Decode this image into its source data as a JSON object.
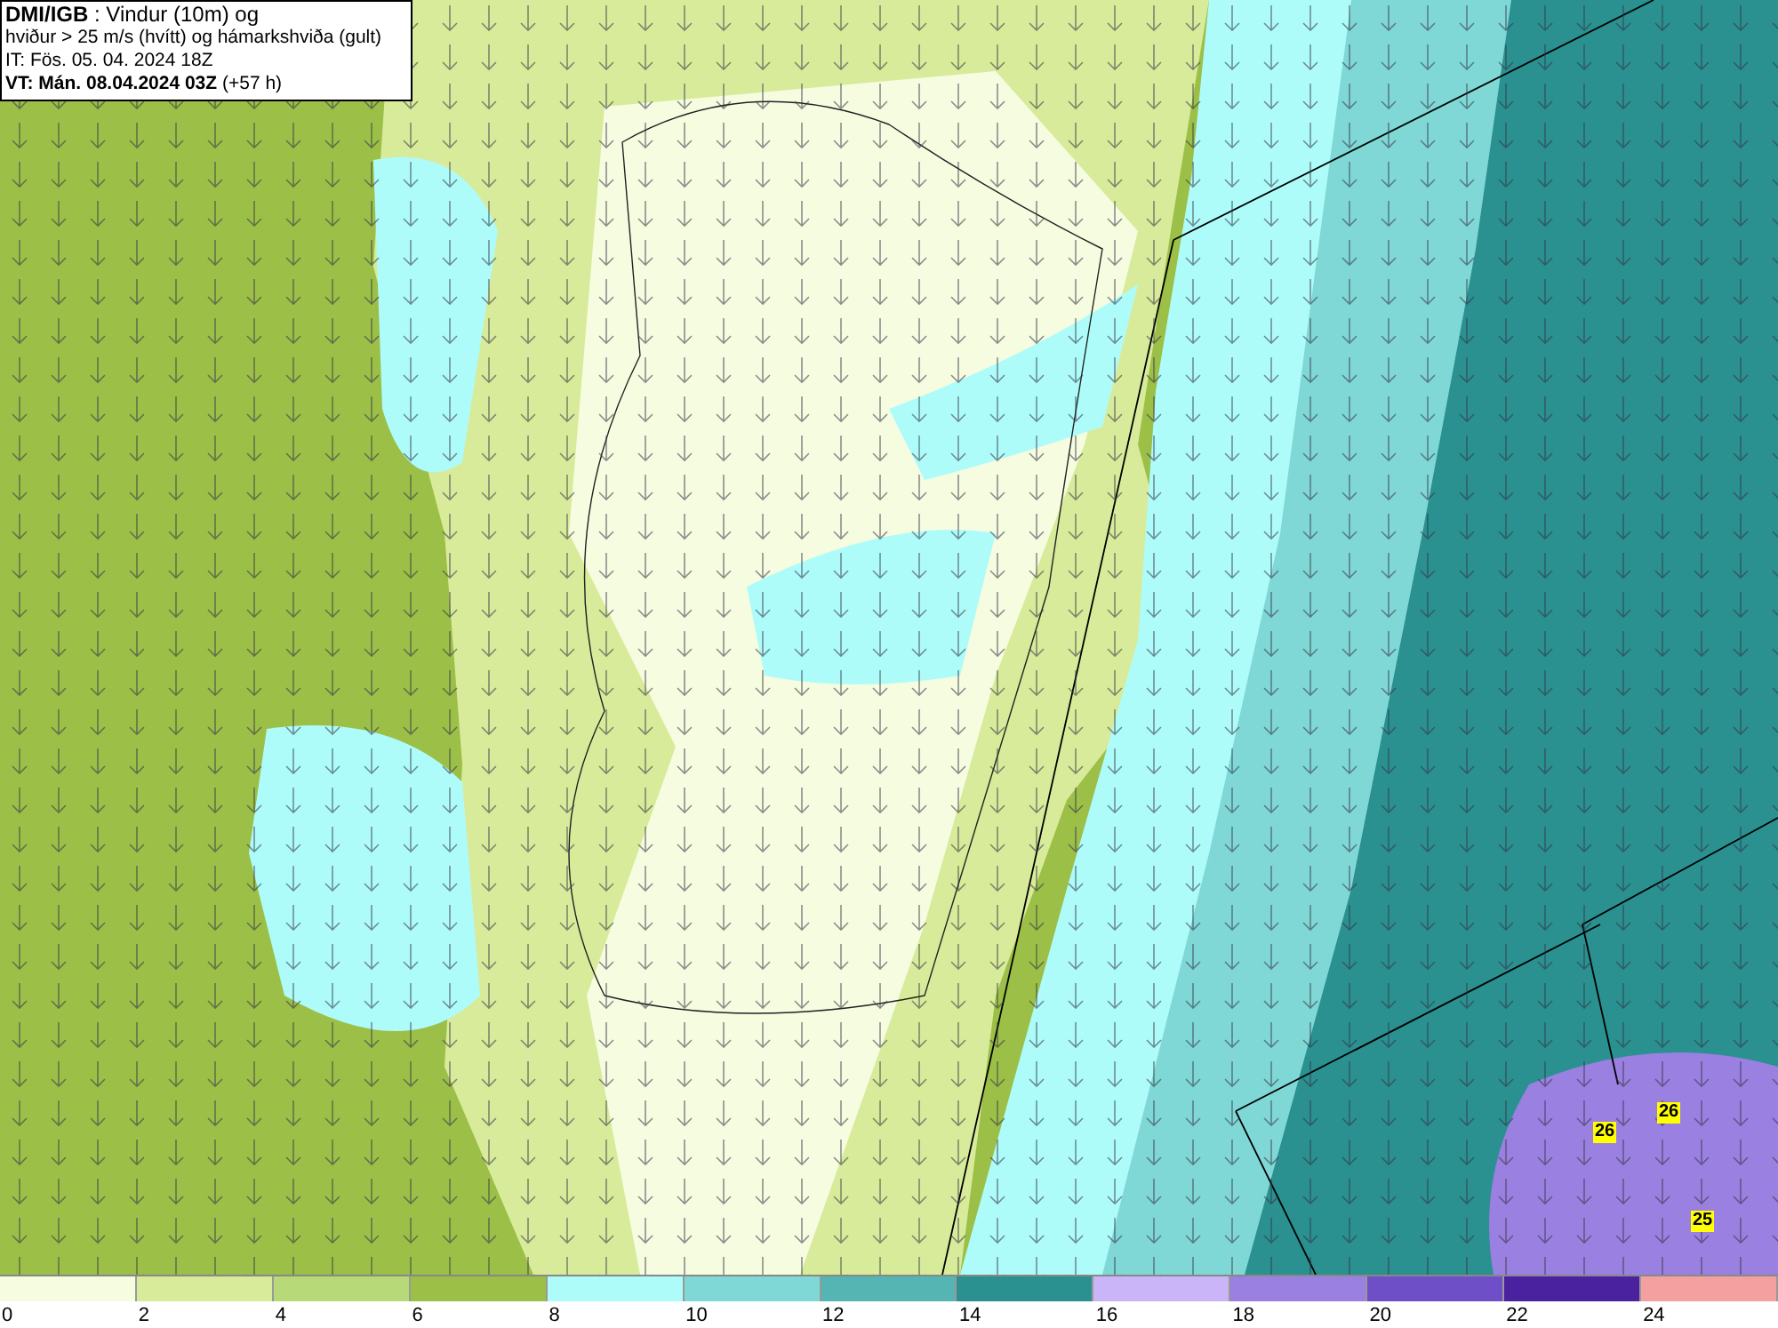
{
  "info": {
    "lines": [
      "**DMI/IGB** : Vindur (10m) og",
      "hviður > 25 m/s (hvítt) og hámarkshviða (gult)",
      "IT: Fös. 05. 04. 2024 18Z",
      "**VT: Mán. 08.04.2024 03Z** (+57 h)"
    ]
  },
  "map": {
    "gusts": [
      "26",
      "26",
      "25"
    ]
  },
  "legend": {
    "bins": [
      {
        "color": "#f5fce0"
      },
      {
        "color": "#d8eb9a"
      },
      {
        "color": "#b8d977"
      },
      {
        "color": "#9cbf48"
      },
      {
        "color": "#aefcfa"
      },
      {
        "color": "#7fd8d6"
      },
      {
        "color": "#55b5b3"
      },
      {
        "color": "#2a9090"
      },
      {
        "color": "#c9b5f7"
      },
      {
        "color": "#9a80e0"
      },
      {
        "color": "#6e4fc8"
      },
      {
        "color": "#4a22a0"
      },
      {
        "color": "#f4a0a0"
      }
    ],
    "labels": [
      "0",
      "2",
      "4",
      "6",
      "8",
      "10",
      "12",
      "14",
      "16",
      "18",
      "20",
      "22",
      "24"
    ]
  }
}
